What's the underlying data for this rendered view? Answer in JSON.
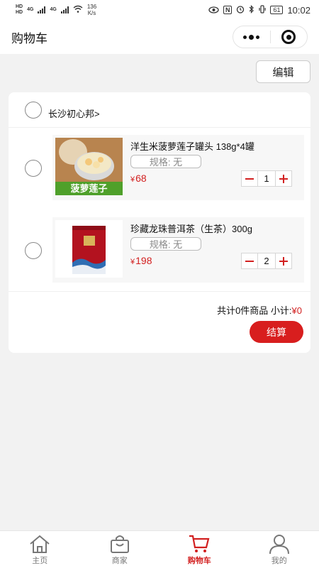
{
  "status_bar": {
    "network_1": "HD",
    "network_2": "HD",
    "gen_1": "4G",
    "gen_2": "4G",
    "speed_value": "136",
    "speed_unit": "K/s",
    "nfc": "N",
    "battery": "61",
    "time": "10:02"
  },
  "nav": {
    "title": "购物车"
  },
  "edit_label": "编辑",
  "shop": {
    "name": "长沙初心邦>"
  },
  "items": [
    {
      "title": "洋生米菠萝莲子罐头 138g*4罐",
      "spec": "规格: 无",
      "currency": "¥",
      "price": "68",
      "qty": "1",
      "image_caption": "菠萝莲子"
    },
    {
      "title": "珍藏龙珠普洱茶（生茶）300g",
      "spec": "规格: 无",
      "currency": "¥",
      "price": "198",
      "qty": "2"
    }
  ],
  "summary": {
    "text": "共计0件商品 小计:",
    "amount": "¥0"
  },
  "checkout_label": "结算",
  "tabs": [
    {
      "label": "主页",
      "icon": "home-icon"
    },
    {
      "label": "商家",
      "icon": "shop-bag-icon"
    },
    {
      "label": "购物车",
      "icon": "cart-icon",
      "active": true
    },
    {
      "label": "我的",
      "icon": "user-icon"
    }
  ],
  "colors": {
    "accent": "#d22020",
    "checkout_bg": "#d81e1e",
    "page_bg": "#f2f2f2"
  }
}
